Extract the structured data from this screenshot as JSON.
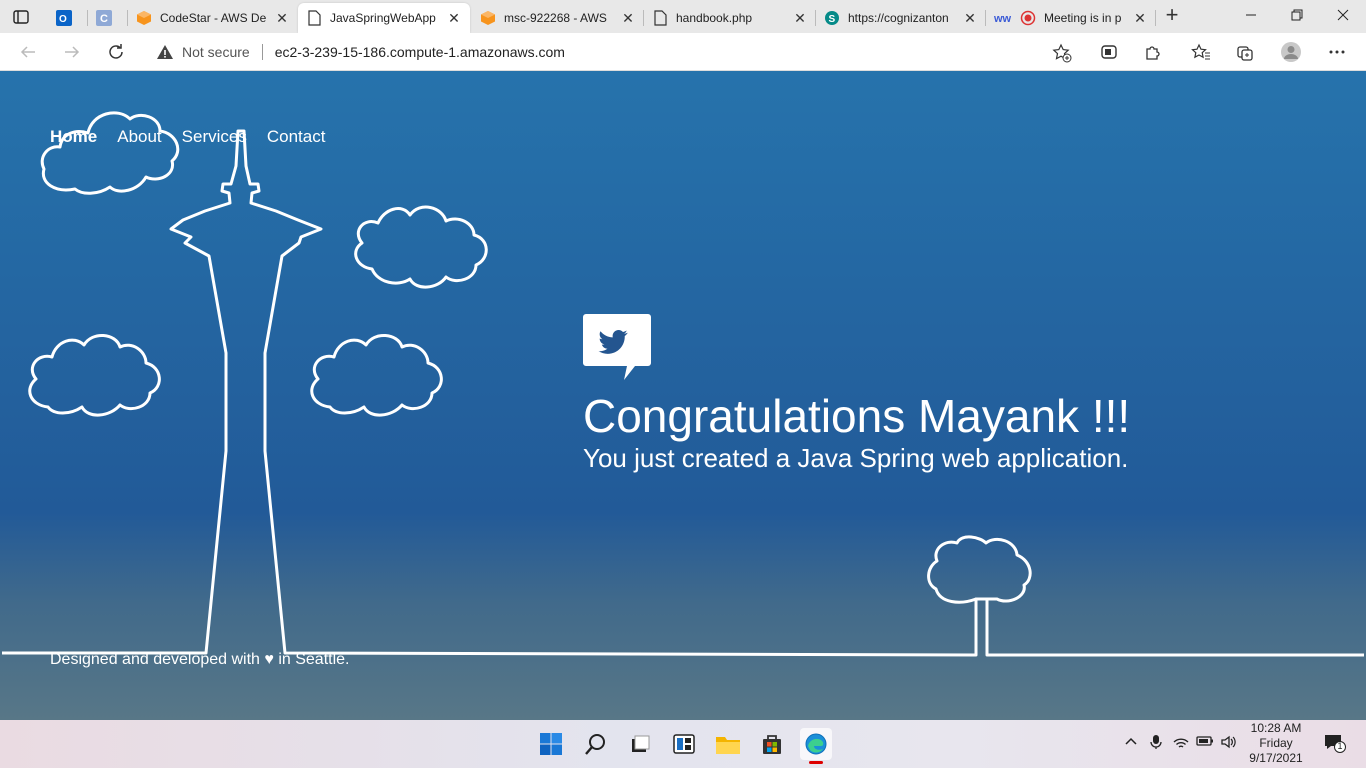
{
  "browser": {
    "tabs": [
      {
        "title": "",
        "icon": "outlook-icon"
      },
      {
        "title": "",
        "icon": "c-icon"
      },
      {
        "title": "CodeStar - AWS De",
        "icon": "aws-cube-icon"
      },
      {
        "title": "JavaSpringWebApp",
        "icon": "page-icon"
      },
      {
        "title": "msc-922268 - AWS",
        "icon": "aws-cube-icon"
      },
      {
        "title": "handbook.php",
        "icon": "page-icon"
      },
      {
        "title": "https://cognizanton",
        "icon": "sharepoint-icon"
      },
      {
        "title": "Meeting is in p",
        "icon": "recording-icon"
      }
    ],
    "address": {
      "security": "Not secure",
      "url": "ec2-3-239-15-186.compute-1.amazonaws.com"
    }
  },
  "page": {
    "nav": {
      "home": "Home",
      "about": "About",
      "services": "Services",
      "contact": "Contact"
    },
    "hero": {
      "title": "Congratulations Mayank !!!",
      "subtitle": "You just created a Java Spring web application."
    },
    "footer": "Designed and developed with ♥ in Seattle."
  },
  "taskbar": {
    "clock": {
      "time": "10:28 AM",
      "day": "Friday",
      "date": "9/17/2021"
    },
    "notifications": "1"
  },
  "colors": {
    "page_top": "#2673ac",
    "page_mid": "#225a98",
    "page_bottom": "#587787"
  }
}
